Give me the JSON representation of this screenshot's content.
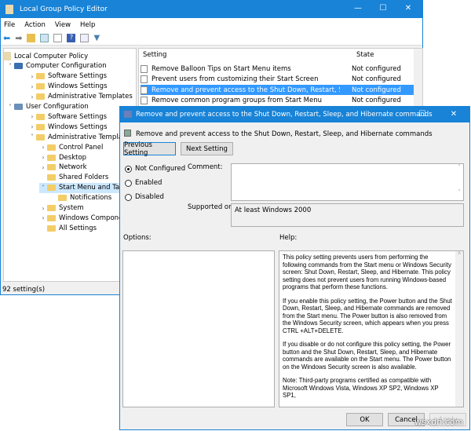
{
  "main": {
    "title": "Local Group Policy Editor",
    "menu": [
      "File",
      "Action",
      "View",
      "Help"
    ],
    "tree": [
      {
        "label": "Local Computer Policy",
        "level": 0,
        "chev": ""
      },
      {
        "label": "Computer Configuration",
        "level": 1,
        "chev": "˅"
      },
      {
        "label": "Software Settings",
        "level": 2,
        "chev": "›"
      },
      {
        "label": "Windows Settings",
        "level": 2,
        "chev": "›"
      },
      {
        "label": "Administrative Templates",
        "level": 2,
        "chev": "›"
      },
      {
        "label": "User Configuration",
        "level": 1,
        "chev": "˅"
      },
      {
        "label": "Software Settings",
        "level": 2,
        "chev": "›"
      },
      {
        "label": "Windows Settings",
        "level": 2,
        "chev": "›"
      },
      {
        "label": "Administrative Templates",
        "level": 2,
        "chev": "˅"
      },
      {
        "label": "Control Panel",
        "level": 3,
        "chev": "›"
      },
      {
        "label": "Desktop",
        "level": 3,
        "chev": "›"
      },
      {
        "label": "Network",
        "level": 3,
        "chev": "›"
      },
      {
        "label": "Shared Folders",
        "level": 3,
        "chev": ""
      },
      {
        "label": "Start Menu and Taskbar",
        "level": 3,
        "chev": "˅",
        "selected": true
      },
      {
        "label": "Notifications",
        "level": 4,
        "chev": ""
      },
      {
        "label": "System",
        "level": 3,
        "chev": "›"
      },
      {
        "label": "Windows Components",
        "level": 3,
        "chev": "›"
      },
      {
        "label": "All Settings",
        "level": 3,
        "chev": ""
      }
    ],
    "list": {
      "col_setting": "Setting",
      "col_state": "State",
      "rows": [
        {
          "setting": "Remove Balloon Tips on Start Menu items",
          "state": "Not configured"
        },
        {
          "setting": "Prevent users from customizing their Start Screen",
          "state": "Not configured"
        },
        {
          "setting": "Remove and prevent access to the Shut Down, Restart, Sleep...",
          "state": "Not configured",
          "selected": true
        },
        {
          "setting": "Remove common program groups from Start Menu",
          "state": "Not configured"
        }
      ]
    },
    "status": "92 setting(s)"
  },
  "dialog": {
    "title": "Remove and prevent access to the Shut Down, Restart, Sleep, and Hibernate commands",
    "header": "Remove and prevent access to the Shut Down, Restart, Sleep, and Hibernate commands",
    "prev": "Previous Setting",
    "next": "Next Setting",
    "radios": [
      "Not Configured",
      "Enabled",
      "Disabled"
    ],
    "selected_radio": "Not Configured",
    "comment_label": "Comment:",
    "supported_label": "Supported on:",
    "supported_value": "At least Windows 2000",
    "options_label": "Options:",
    "help_label": "Help:",
    "help": [
      "This policy setting prevents users from performing the following commands from the Start menu or Windows Security screen: Shut Down, Restart, Sleep, and Hibernate. This policy setting does not prevent users from running Windows-based programs that perform these functions.",
      "If you enable this policy setting, the Power button and the Shut Down, Restart, Sleep, and Hibernate commands are removed from the Start menu. The Power button is also removed from the Windows Security screen, which appears when you press CTRL +ALT+DELETE.",
      "If you disable or do not configure this policy setting, the Power button and the Shut Down, Restart, Sleep, and Hibernate commands are available on the Start menu. The Power button on the Windows Security screen is also available.",
      "Note: Third-party programs certified as compatible with Microsoft Windows Vista, Windows XP SP2, Windows XP SP1,"
    ],
    "ok": "OK",
    "cancel": "Cancel",
    "apply": "Apply"
  },
  "watermark": "wsxdn.com"
}
